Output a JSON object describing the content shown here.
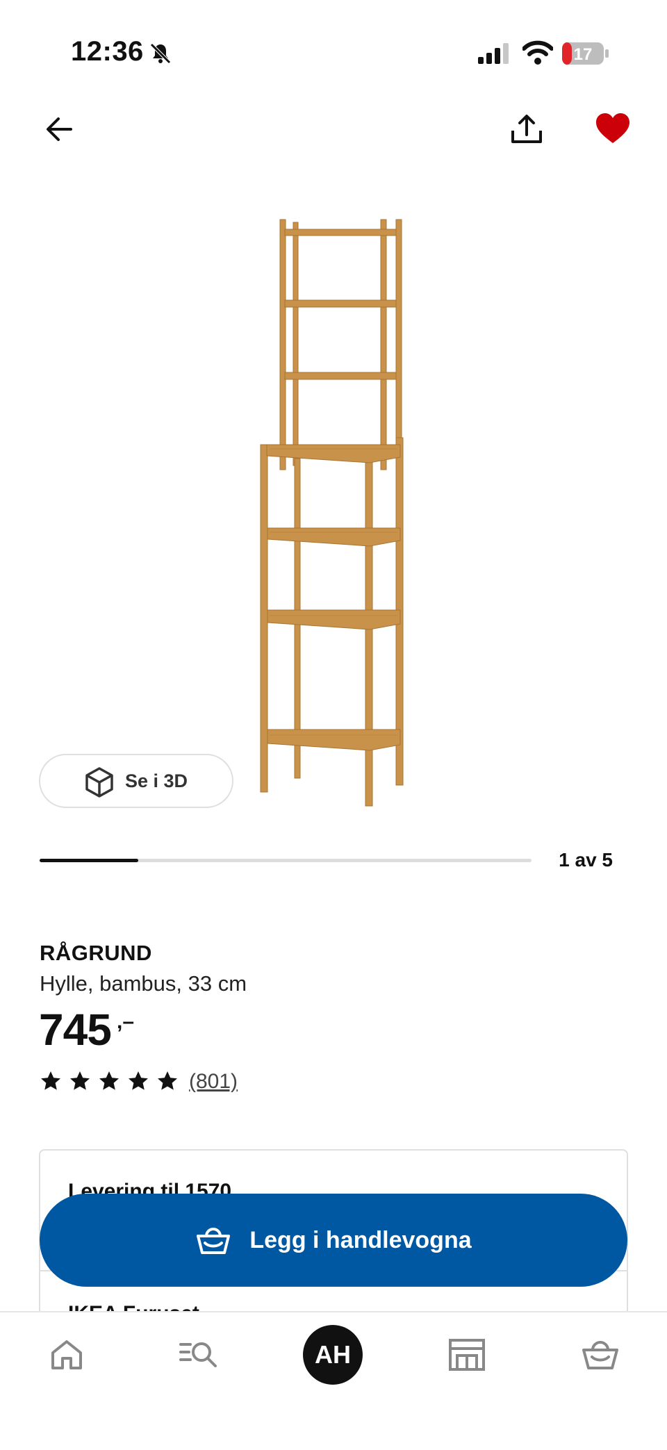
{
  "status_bar": {
    "time": "12:36",
    "battery": "17"
  },
  "product": {
    "name": "RÅGRUND",
    "description": "Hylle, bambus, 33 cm",
    "price": "745",
    "price_suffix": ",–",
    "rating_stars": 5,
    "review_count": "(801)"
  },
  "gallery": {
    "view_3d_label": "Se i 3D",
    "pager": "1 av 5",
    "progress_fraction": 0.2
  },
  "delivery": {
    "title": "Levering til 1570",
    "store_title": "IKEA Furuset"
  },
  "cta": {
    "add_to_cart_label": "Legg i handlevogna"
  },
  "tab_bar": {
    "avatar_initials": "AH"
  },
  "colors": {
    "brand_blue": "#0058a3",
    "favorite_red": "#cc0008",
    "wood": "#c8924a"
  }
}
